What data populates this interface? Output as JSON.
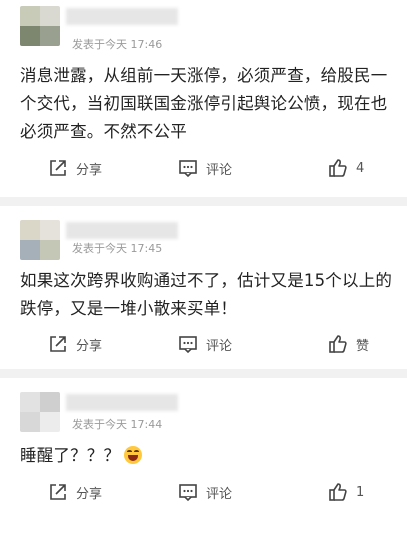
{
  "comments": [
    {
      "time": "发表于今天 17:46",
      "content": "消息泄露，从组前一天涨停，必须严查，给股民一个交代，当初国联国金涨停引起舆论公愤，现在也必须严查。不然不公平",
      "share_label": "分享",
      "comment_label": "评论",
      "like_label": "4"
    },
    {
      "time": "发表于今天 17:45",
      "content": "如果这次跨界收购通过不了，估计又是15个以上的跌停，又是一堆小散来买单！",
      "share_label": "分享",
      "comment_label": "评论",
      "like_label": "赞"
    },
    {
      "time": "发表于今天 17:44",
      "content": "睡醒了？？？",
      "emoji": "grinning-face-emoji",
      "share_label": "分享",
      "comment_label": "评论",
      "like_label": "1"
    }
  ],
  "icons": {
    "share": "share-icon",
    "comment": "comment-icon",
    "like": "thumbs-up-icon"
  },
  "colors": {
    "text": "#222222",
    "meta": "#9a9a9a",
    "icon": "#555555",
    "separator": "#f1f1f1"
  }
}
